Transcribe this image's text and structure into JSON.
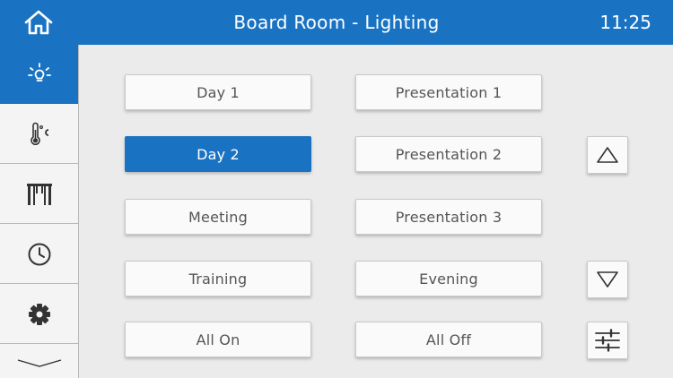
{
  "header": {
    "title": "Board Room - Lighting",
    "time": "11:25",
    "home_icon": "home-icon"
  },
  "sidebar": {
    "items": [
      {
        "name": "lighting",
        "icon": "lightbulb-icon",
        "active": true
      },
      {
        "name": "climate",
        "icon": "thermometer-celsius-icon",
        "active": false
      },
      {
        "name": "blinds",
        "icon": "blinds-icon",
        "active": false
      },
      {
        "name": "schedule",
        "icon": "clock-icon",
        "active": false
      },
      {
        "name": "settings",
        "icon": "gear-icon",
        "active": false
      }
    ],
    "more_icon": "chevron-down-icon"
  },
  "scenes": {
    "left": [
      {
        "label": "Day 1",
        "active": false
      },
      {
        "label": "Day 2",
        "active": true
      },
      {
        "label": "Meeting",
        "active": false
      },
      {
        "label": "Training",
        "active": false
      },
      {
        "label": "All On",
        "active": false
      }
    ],
    "right": [
      {
        "label": "Presentation 1",
        "active": false
      },
      {
        "label": "Presentation 2",
        "active": false
      },
      {
        "label": "Presentation 3",
        "active": false
      },
      {
        "label": "Evening",
        "active": false
      },
      {
        "label": "All Off",
        "active": false
      }
    ]
  },
  "controls": {
    "up_icon": "triangle-up-icon",
    "down_icon": "triangle-down-icon",
    "adjust_icon": "sliders-icon"
  },
  "colors": {
    "accent": "#1a73c2",
    "background": "#ebebeb",
    "button_text": "#555555"
  }
}
